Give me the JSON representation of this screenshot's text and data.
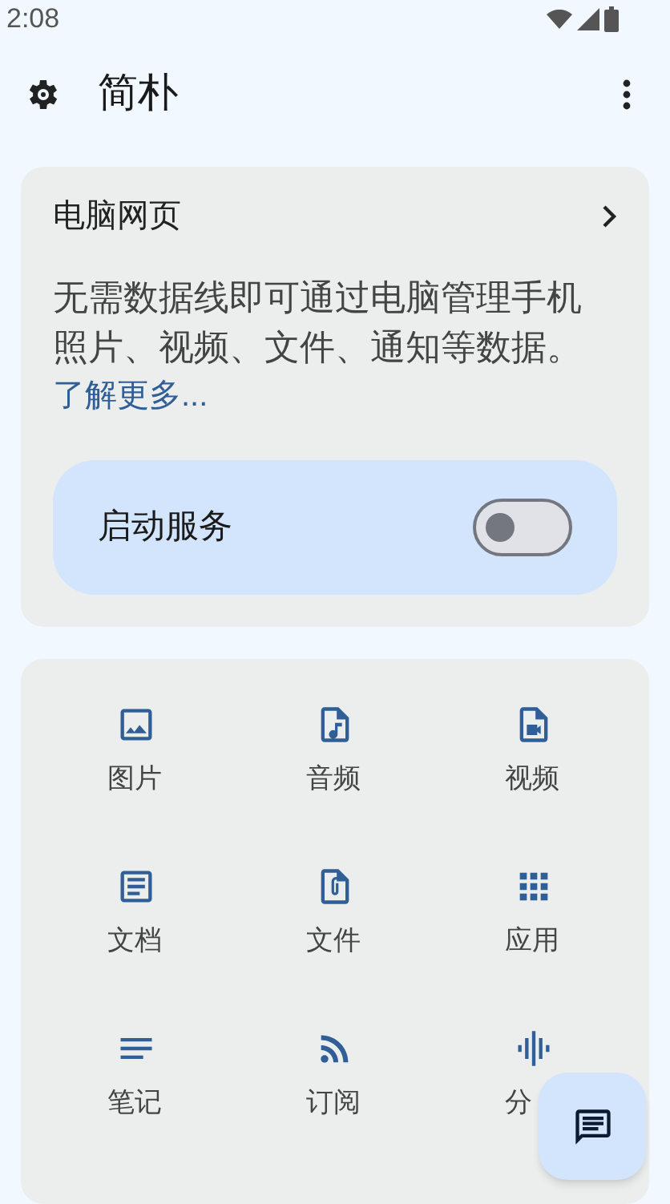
{
  "status_bar": {
    "time": "2:08"
  },
  "app_bar": {
    "title": "简朴"
  },
  "web_card": {
    "title": "电脑网页",
    "description": "无需数据线即可通过电脑管理手机照片、视频、文件、通知等数据。",
    "link": "了解更多...",
    "service": {
      "label": "启动服务",
      "on": false
    }
  },
  "features": [
    {
      "label": "图片"
    },
    {
      "label": "音频"
    },
    {
      "label": "视频"
    },
    {
      "label": "文档"
    },
    {
      "label": "文件"
    },
    {
      "label": "应用"
    },
    {
      "label": "笔记"
    },
    {
      "label": "订阅"
    },
    {
      "label": "分"
    }
  ]
}
